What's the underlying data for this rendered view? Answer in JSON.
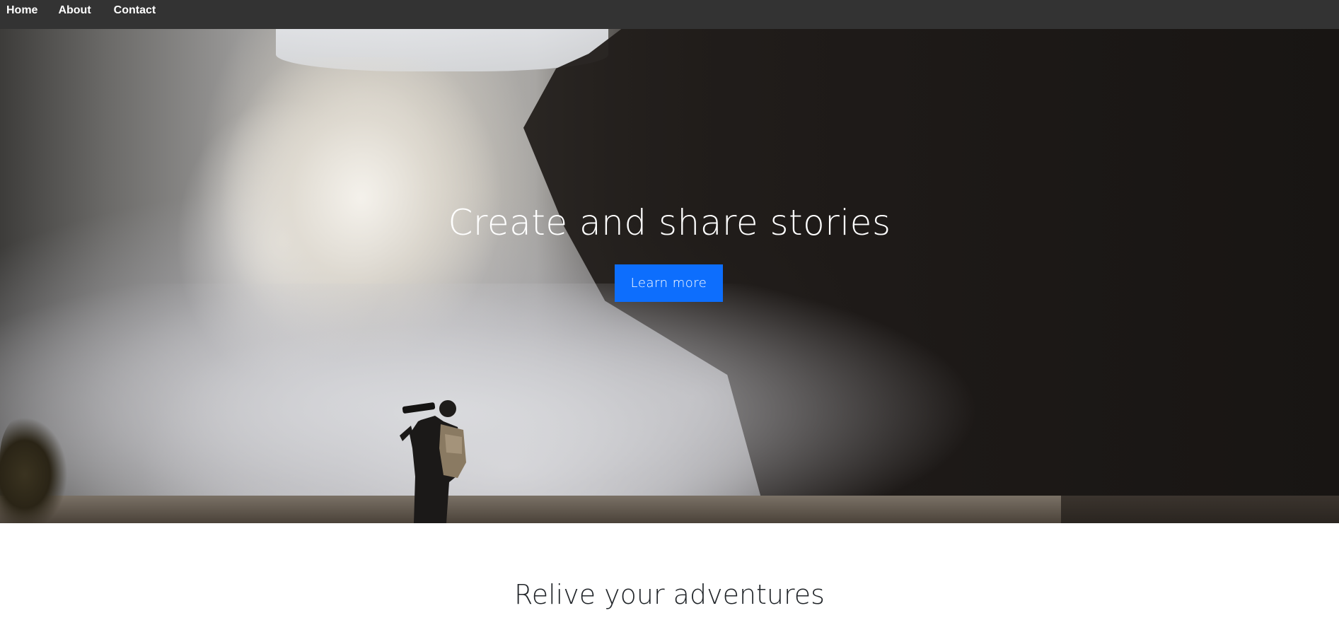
{
  "navbar": {
    "links": [
      {
        "label": "Home"
      },
      {
        "label": "About"
      },
      {
        "label": "Contact"
      }
    ],
    "background_color": "#333333"
  },
  "hero": {
    "title": "Create and share stories",
    "button_label": "Learn more",
    "button_color": "#0d6efd",
    "background_image": "waterfall-photographer-photo"
  },
  "section": {
    "title": "Relive your adventures"
  }
}
